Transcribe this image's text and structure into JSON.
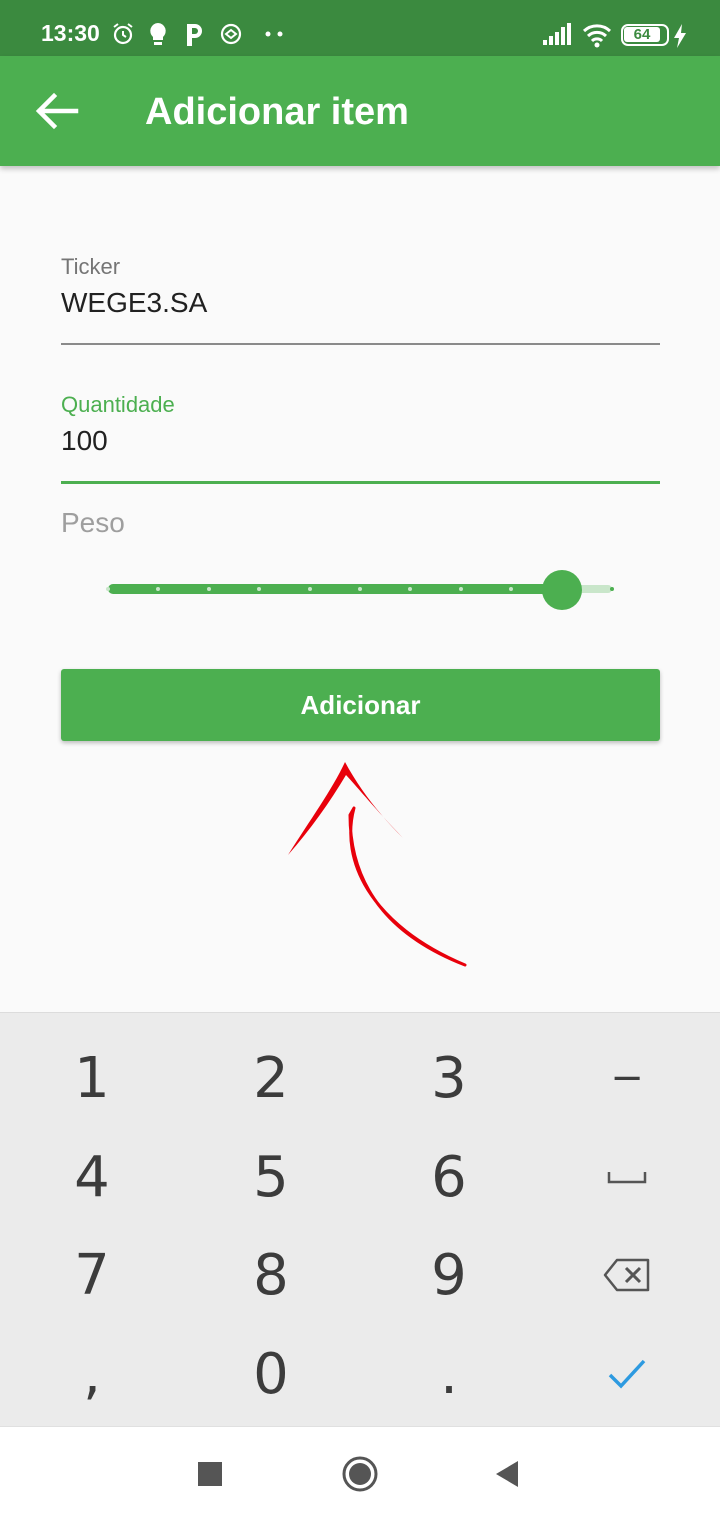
{
  "status_bar": {
    "time": "13:30",
    "battery": "64",
    "icons": [
      "alarm-icon",
      "bulb-icon",
      "parking-p-icon",
      "sync-icon",
      "more-dots-icon",
      "signal-icon",
      "wifi-icon",
      "battery-icon",
      "charging-icon"
    ]
  },
  "app_bar": {
    "title": "Adicionar item",
    "back_icon": "arrow-back-icon"
  },
  "form": {
    "ticker": {
      "label": "Ticker",
      "value": "WEGE3.SA"
    },
    "quantity": {
      "label": "Quantidade",
      "value": "100"
    },
    "weight": {
      "label": "Peso",
      "slider_fraction": 0.9,
      "divisions": 10
    }
  },
  "button": {
    "label": "Adicionar"
  },
  "keyboard": {
    "keys": [
      [
        "1",
        "2",
        "3",
        "−"
      ],
      [
        "4",
        "5",
        "6",
        "space"
      ],
      [
        "7",
        "8",
        "9",
        "backspace"
      ],
      [
        ",",
        "0",
        ".",
        "done"
      ]
    ]
  },
  "nav_bar": {
    "icons": [
      "recents-square-icon",
      "home-circle-icon",
      "back-triangle-icon"
    ]
  },
  "colors": {
    "primary": "#4caf50",
    "status_bar": "#3b8a3f",
    "annotation_red": "#e8000b",
    "done_check": "#2d9ae0"
  }
}
